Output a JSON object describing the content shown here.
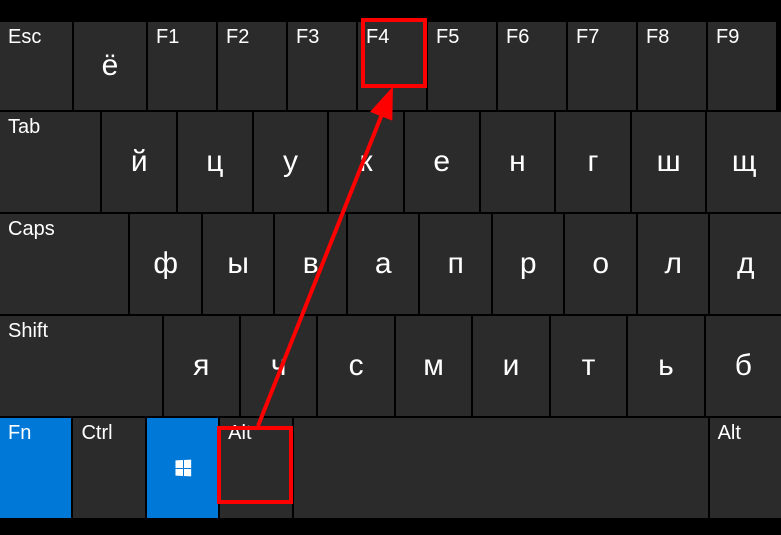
{
  "row1": {
    "esc": "Esc",
    "yo": "ё",
    "f": [
      "F1",
      "F2",
      "F3",
      "F4",
      "F5",
      "F6",
      "F7",
      "F8",
      "F9"
    ]
  },
  "row2": {
    "tab": "Tab",
    "letters": [
      "й",
      "ц",
      "у",
      "к",
      "е",
      "н",
      "г",
      "ш",
      "щ"
    ]
  },
  "row3": {
    "caps": "Caps",
    "letters": [
      "ф",
      "ы",
      "в",
      "а",
      "п",
      "р",
      "о",
      "л",
      "д"
    ]
  },
  "row4": {
    "shift": "Shift",
    "letters": [
      "я",
      "ч",
      "с",
      "м",
      "и",
      "т",
      "ь",
      "б"
    ]
  },
  "row5": {
    "fn": "Fn",
    "ctrl": "Ctrl",
    "alt": "Alt",
    "altR": "Alt"
  },
  "annotation": {
    "highlight_keys": [
      "F4",
      "Alt"
    ],
    "arrow_from": "Alt",
    "arrow_to": "F4",
    "color": "#ff0000"
  }
}
